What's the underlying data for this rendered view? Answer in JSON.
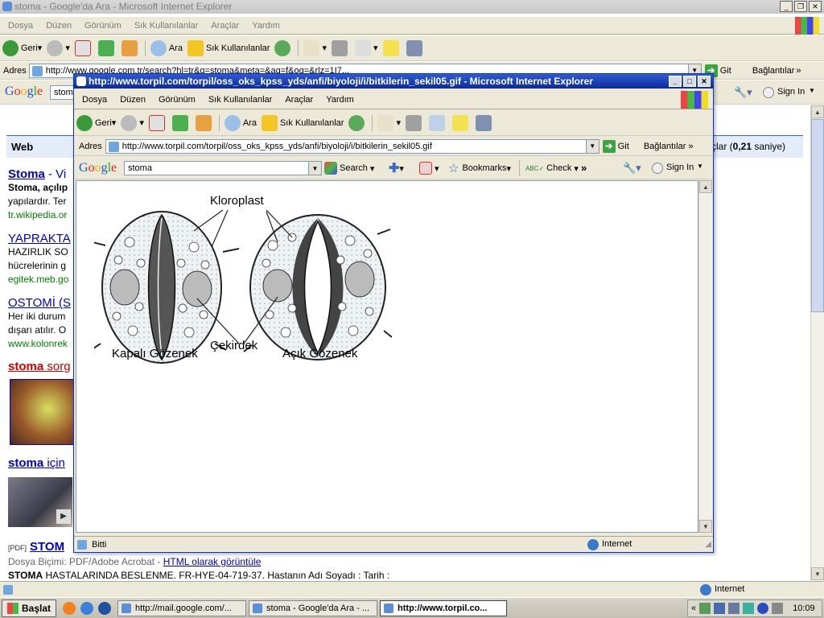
{
  "bg_window": {
    "title": "stoma - Google'da Ara - Microsoft Internet Explorer",
    "menu": [
      "Dosya",
      "Düzen",
      "Görünüm",
      "Sık Kullanılanlar",
      "Araçlar",
      "Yardım"
    ],
    "toolbar": {
      "back": "Geri",
      "search": "Ara",
      "favorites": "Sık Kullanılanlar"
    },
    "address_label": "Adres",
    "address_value": "http://www.google.com.tr/search?hl=tr&q=stoma&meta=&aq=f&oq=&rlz=1I7...",
    "go_label": "Git",
    "links_label": "Bağlantılar",
    "google_search_value": "stom",
    "signin": "Sign In",
    "tab_web": "Web",
    "results_suffix": "çlar (",
    "results_time": "0,21",
    "results_time_unit": " saniye)",
    "results": [
      {
        "title": "Stoma",
        "title_rest": " - Vi",
        "snippet1": "Stoma, açılıp",
        "snippet2": "yapılardır. Ter",
        "url": "tr.wikipedia.or"
      },
      {
        "title": "YAPRAKTA",
        "title_rest": "",
        "snippet1": "HAZIRLIK SO",
        "snippet2": "hücrelerinin g",
        "url": "egitek.meb.go"
      },
      {
        "title": "OSTOMİ (S",
        "title_rest": "",
        "snippet1": "Her iki durum",
        "snippet2": "dışarı atılır. O",
        "url": "www.kolonrek"
      }
    ],
    "image_result_title": "stoma",
    "image_result_rest": " sorg",
    "video_result_title": "stoma",
    "video_result_rest": " için",
    "pdf_tag": "[PDF]",
    "pdf_title": "STOM",
    "pdf_format": "Dosya Biçimi: PDF/Adobe Acrobat - ",
    "pdf_html_link": "HTML olarak görüntüle",
    "pdf_snippet_bold": "STOMA",
    "pdf_snippet": " HASTALARINDA BESLENME. FR-HYE-04-719-37. Hastanın Adı Soyadı : Tarih :",
    "status_zone": "Internet"
  },
  "fg_window": {
    "title": "http://www.torpil.com/torpil/oss_oks_kpss_yds/anfi/biyoloji/i/bitkilerin_sekil05.gif - Microsoft Internet Explorer",
    "menu": [
      "Dosya",
      "Düzen",
      "Görünüm",
      "Sık Kullanılanlar",
      "Araçlar",
      "Yardım"
    ],
    "toolbar": {
      "back": "Geri",
      "search": "Ara",
      "favorites": "Sık Kullanılanlar"
    },
    "address_label": "Adres",
    "address_value": "http://www.torpil.com/torpil/oss_oks_kpss_yds/anfi/biyoloji/i/bitkilerin_sekil05.gif",
    "go_label": "Git",
    "links_label": "Bağlantılar",
    "google_logo": "Google",
    "google_search_value": "stoma",
    "google_search_btn": "Search",
    "bookmarks": "Bookmarks",
    "check": "Check",
    "signin": "Sign In",
    "status_text": "Bitti",
    "status_zone": "Internet",
    "figure": {
      "label_chloroplast": "Kloroplast",
      "label_closed": "Kapalı Gözenek",
      "label_nucleus": "Çekirdek",
      "label_open": "Açık Gözenek"
    }
  },
  "taskbar": {
    "start": "Başlat",
    "tasks": [
      "http://mail.google.com/...",
      "stoma - Google'da Ara - ...",
      "http://www.torpil.co..."
    ],
    "clock": "10:09"
  }
}
